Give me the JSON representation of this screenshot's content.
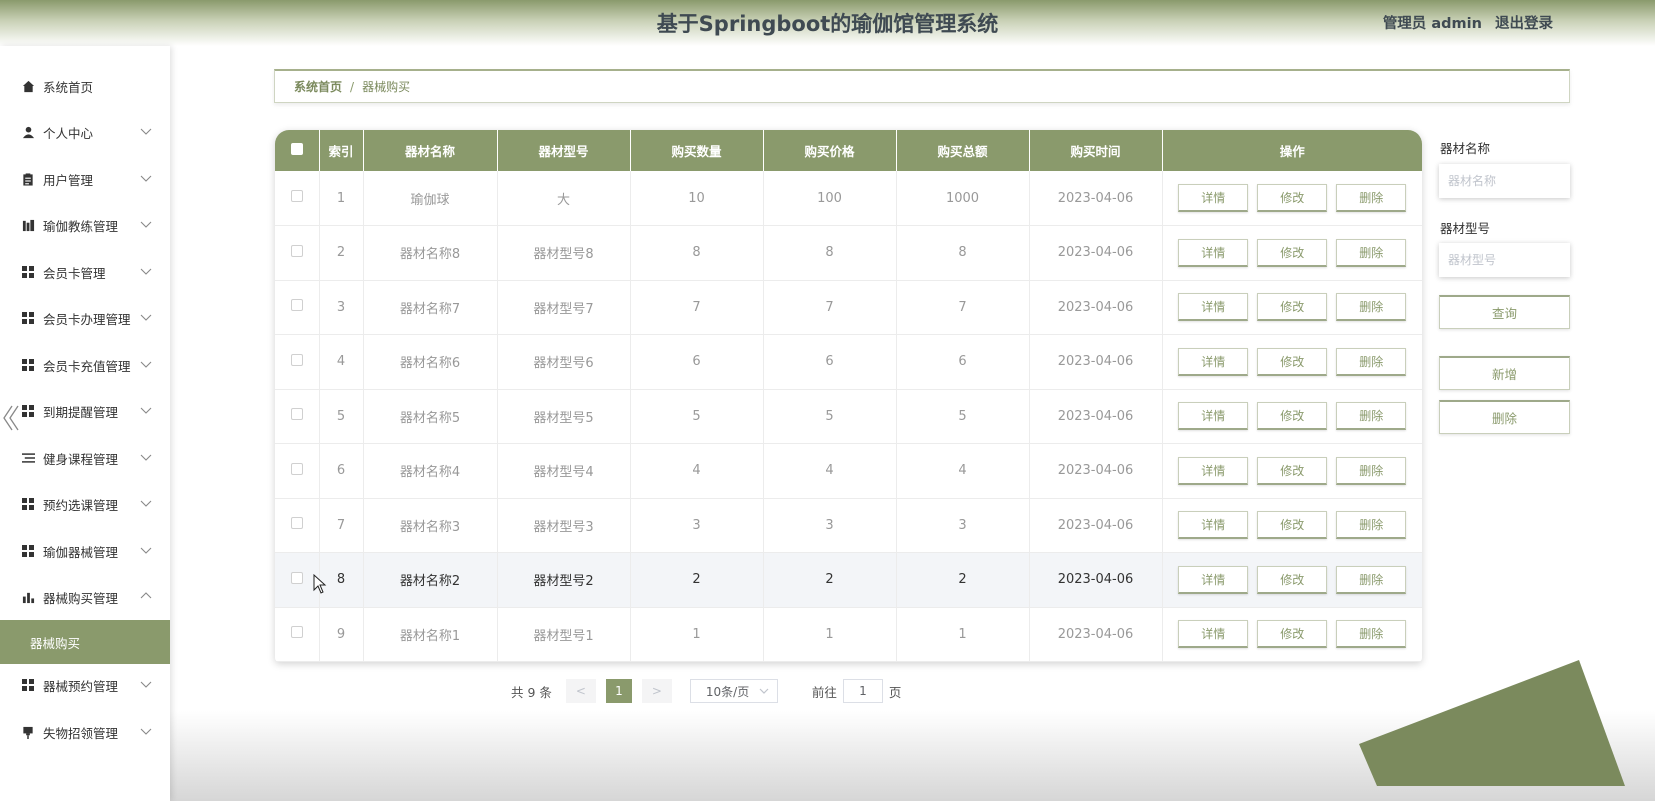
{
  "header": {
    "title": "基于Springboot的瑜伽馆管理系统",
    "role_user": "管理员 admin",
    "logout": "退出登录"
  },
  "sidebar": {
    "items": [
      {
        "label": "系统首页",
        "icon": "home-icon",
        "chevron": ""
      },
      {
        "label": "个人中心",
        "icon": "person-icon",
        "chevron": "down"
      },
      {
        "label": "用户管理",
        "icon": "clipboard-icon",
        "chevron": "down"
      },
      {
        "label": "瑜伽教练管理",
        "icon": "books-icon",
        "chevron": "down"
      },
      {
        "label": "会员卡管理",
        "icon": "grid-icon",
        "chevron": "down"
      },
      {
        "label": "会员卡办理管理",
        "icon": "grid-icon",
        "chevron": "down"
      },
      {
        "label": "会员卡充值管理",
        "icon": "grid-icon",
        "chevron": "down"
      },
      {
        "label": "到期提醒管理",
        "icon": "grid-icon",
        "chevron": "down"
      },
      {
        "label": "健身课程管理",
        "icon": "list-icon",
        "chevron": "down"
      },
      {
        "label": "预约选课管理",
        "icon": "grid-icon",
        "chevron": "down"
      },
      {
        "label": "瑜伽器械管理",
        "icon": "grid-icon",
        "chevron": "down"
      },
      {
        "label": "器械购买管理",
        "icon": "bar-chart-icon",
        "chevron": "up"
      },
      {
        "label": "器械购买",
        "icon": "",
        "chevron": "",
        "active_sub": true
      },
      {
        "label": "器械预约管理",
        "icon": "grid-icon",
        "chevron": "down"
      },
      {
        "label": "失物招领管理",
        "icon": "pin-icon",
        "chevron": "down"
      }
    ]
  },
  "breadcrumb": {
    "home": "系统首页",
    "separator": "/",
    "current": "器械购买"
  },
  "table": {
    "columns": [
      "索引",
      "器材名称",
      "器材型号",
      "购买数量",
      "购买价格",
      "购买总额",
      "购买时间",
      "操作"
    ],
    "rows": [
      {
        "index": "1",
        "name": "瑜伽球",
        "model": "大",
        "qty": "10",
        "price": "100",
        "total": "1000",
        "date": "2023-04-06"
      },
      {
        "index": "2",
        "name": "器材名称8",
        "model": "器材型号8",
        "qty": "8",
        "price": "8",
        "total": "8",
        "date": "2023-04-06"
      },
      {
        "index": "3",
        "name": "器材名称7",
        "model": "器材型号7",
        "qty": "7",
        "price": "7",
        "total": "7",
        "date": "2023-04-06"
      },
      {
        "index": "4",
        "name": "器材名称6",
        "model": "器材型号6",
        "qty": "6",
        "price": "6",
        "total": "6",
        "date": "2023-04-06"
      },
      {
        "index": "5",
        "name": "器材名称5",
        "model": "器材型号5",
        "qty": "5",
        "price": "5",
        "total": "5",
        "date": "2023-04-06"
      },
      {
        "index": "6",
        "name": "器材名称4",
        "model": "器材型号4",
        "qty": "4",
        "price": "4",
        "total": "4",
        "date": "2023-04-06"
      },
      {
        "index": "7",
        "name": "器材名称3",
        "model": "器材型号3",
        "qty": "3",
        "price": "3",
        "total": "3",
        "date": "2023-04-06"
      },
      {
        "index": "8",
        "name": "器材名称2",
        "model": "器材型号2",
        "qty": "2",
        "price": "2",
        "total": "2",
        "date": "2023-04-06",
        "highlight": true
      },
      {
        "index": "9",
        "name": "器材名称1",
        "model": "器材型号1",
        "qty": "1",
        "price": "1",
        "total": "1",
        "date": "2023-04-06"
      }
    ],
    "actions": {
      "detail": "详情",
      "edit": "修改",
      "delete": "删除"
    }
  },
  "pagination": {
    "total": "共 9 条",
    "prev": "<",
    "current_page": "1",
    "next": ">",
    "page_size": "10条/页",
    "goto_label": "前往",
    "goto_value": "1",
    "page_suffix": "页"
  },
  "search": {
    "name_label": "器材名称",
    "name_placeholder": "器材名称",
    "model_label": "器材型号",
    "model_placeholder": "器材型号",
    "query_button": "查询",
    "add_button": "新增",
    "delete_button": "删除"
  },
  "colors": {
    "accent": "#8a9a6c",
    "header_text": "#3f4a52"
  }
}
